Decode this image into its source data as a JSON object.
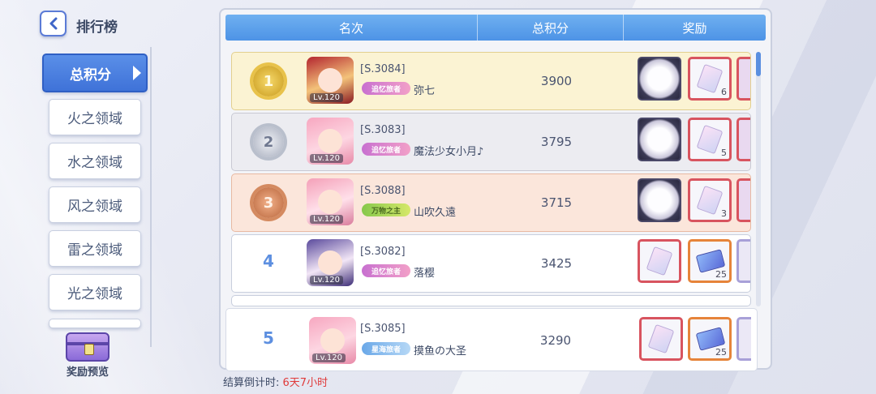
{
  "header": {
    "title": "排行榜"
  },
  "tabs": [
    {
      "label": "总积分",
      "active": true
    },
    {
      "label": "火之领域"
    },
    {
      "label": "水之领域"
    },
    {
      "label": "风之领域"
    },
    {
      "label": "雷之领域"
    },
    {
      "label": "光之领域"
    }
  ],
  "reward_preview": {
    "label": "奖励预览"
  },
  "table": {
    "columns": [
      "名次",
      "总积分",
      "奖励"
    ],
    "rows": [
      {
        "rank": "1",
        "server": "[S.3084]",
        "name": "弥七",
        "score": "3900",
        "level": "Lv.120",
        "title_badge": "追忆旅者",
        "rewards": [
          {
            "type": "frame-icon",
            "qty": ""
          },
          {
            "type": "crystal-icon",
            "qty": "6"
          }
        ]
      },
      {
        "rank": "2",
        "server": "[S.3083]",
        "name": "魔法少女小月♪",
        "score": "3795",
        "level": "Lv.120",
        "title_badge": "追忆旅者",
        "rewards": [
          {
            "type": "frame-icon",
            "qty": ""
          },
          {
            "type": "crystal-icon",
            "qty": "5"
          }
        ]
      },
      {
        "rank": "3",
        "server": "[S.3088]",
        "name": "山吹久遠",
        "score": "3715",
        "level": "Lv.120",
        "title_badge": "万物之主",
        "rewards": [
          {
            "type": "frame-icon",
            "qty": ""
          },
          {
            "type": "crystal-icon",
            "qty": "3"
          }
        ]
      },
      {
        "rank": "4",
        "server": "[S.3082]",
        "name": "落樱",
        "score": "3425",
        "level": "Lv.120",
        "title_badge": "追忆旅者",
        "rewards": [
          {
            "type": "crystal-icon",
            "qty": ""
          },
          {
            "type": "ticket-icon",
            "qty": "25"
          }
        ]
      }
    ],
    "my_row": {
      "rank": "5",
      "server": "[S.3085]",
      "name": "摸鱼の大圣",
      "score": "3290",
      "level": "Lv.120",
      "title_badge": "星海旅者",
      "rewards": [
        {
          "type": "crystal-icon",
          "qty": ""
        },
        {
          "type": "ticket-icon",
          "qty": "25"
        }
      ]
    }
  },
  "footer": {
    "countdown_label": "结算倒计时:",
    "countdown_value": "6天7小时"
  },
  "colors": {
    "accent": "#4d93e6",
    "countdown": "#e03a3a",
    "gold_row": "#fbf3d3",
    "silver_row": "#ececf1",
    "bronze_row": "#fbe6db"
  }
}
